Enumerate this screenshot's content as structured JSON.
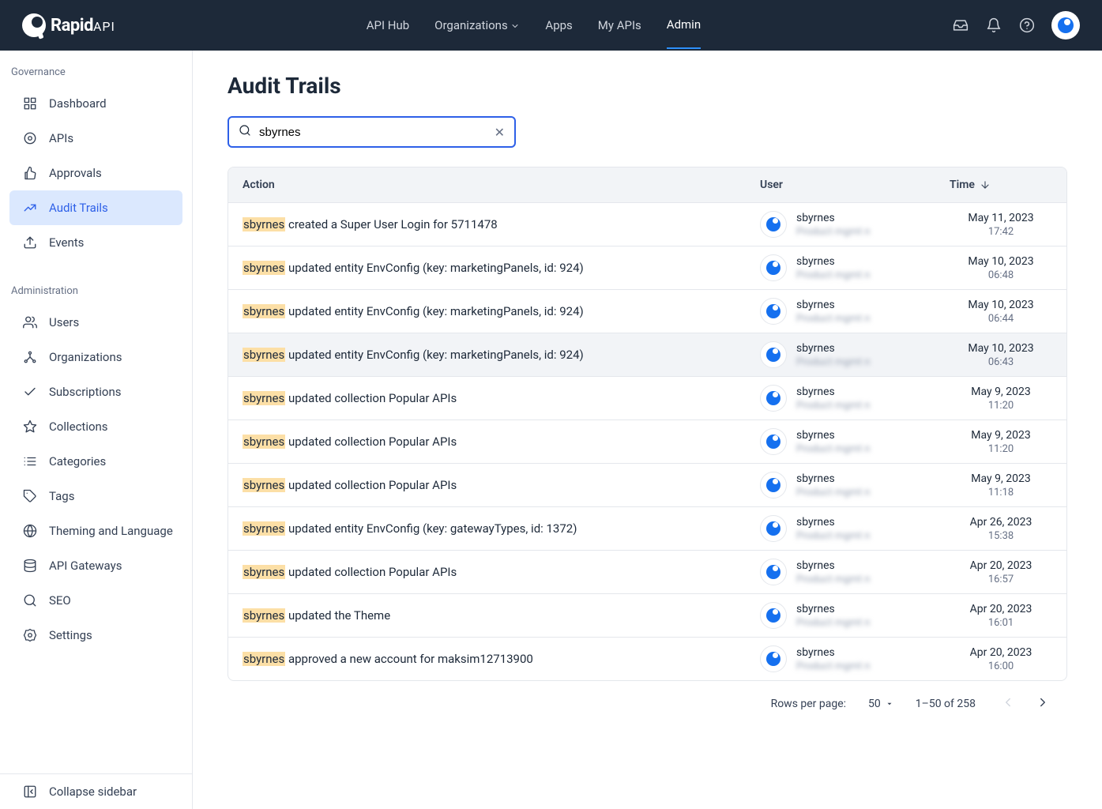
{
  "header": {
    "logo_text": "Rapid",
    "logo_api": "API",
    "nav": [
      "API Hub",
      "Organizations",
      "Apps",
      "My APIs",
      "Admin"
    ],
    "active_nav": 4
  },
  "sidebar": {
    "sections": [
      {
        "heading": "Governance",
        "items": [
          {
            "icon": "dashboard",
            "label": "Dashboard"
          },
          {
            "icon": "api",
            "label": "APIs"
          },
          {
            "icon": "thumbs-up",
            "label": "Approvals"
          },
          {
            "icon": "chart",
            "label": "Audit Trails",
            "active": true
          },
          {
            "icon": "upload",
            "label": "Events"
          }
        ]
      },
      {
        "heading": "Administration",
        "items": [
          {
            "icon": "users",
            "label": "Users"
          },
          {
            "icon": "org",
            "label": "Organizations"
          },
          {
            "icon": "check",
            "label": "Subscriptions"
          },
          {
            "icon": "star",
            "label": "Collections"
          },
          {
            "icon": "list",
            "label": "Categories"
          },
          {
            "icon": "tag",
            "label": "Tags"
          },
          {
            "icon": "globe",
            "label": "Theming and Language"
          },
          {
            "icon": "database",
            "label": "API Gateways"
          },
          {
            "icon": "search",
            "label": "SEO"
          },
          {
            "icon": "settings",
            "label": "Settings"
          }
        ]
      }
    ],
    "collapse": "Collapse sidebar"
  },
  "main": {
    "title": "Audit Trails",
    "search_value": "sbyrnes",
    "columns": {
      "action": "Action",
      "user": "User",
      "time": "Time"
    },
    "highlight_term": "sbyrnes",
    "rows": [
      {
        "action": "created a Super User Login for 5711478",
        "user": "sbyrnes",
        "sub": "Product mgmt n",
        "date": "May 11, 2023",
        "time": "17:42"
      },
      {
        "action": "updated entity EnvConfig (key: marketingPanels, id: 924)",
        "user": "sbyrnes",
        "sub": "Product mgmt n",
        "date": "May 10, 2023",
        "time": "06:48"
      },
      {
        "action": "updated entity EnvConfig (key: marketingPanels, id: 924)",
        "user": "sbyrnes",
        "sub": "Product mgmt n",
        "date": "May 10, 2023",
        "time": "06:44"
      },
      {
        "action": "updated entity EnvConfig (key: marketingPanels, id: 924)",
        "user": "sbyrnes",
        "sub": "Product mgmt n",
        "date": "May 10, 2023",
        "time": "06:43",
        "hover": true
      },
      {
        "action": "updated collection Popular APIs",
        "user": "sbyrnes",
        "sub": "Product mgmt n",
        "date": "May 9, 2023",
        "time": "11:20"
      },
      {
        "action": "updated collection Popular APIs",
        "user": "sbyrnes",
        "sub": "Product mgmt n",
        "date": "May 9, 2023",
        "time": "11:20"
      },
      {
        "action": "updated collection Popular APIs",
        "user": "sbyrnes",
        "sub": "Product mgmt n",
        "date": "May 9, 2023",
        "time": "11:18"
      },
      {
        "action": "updated entity EnvConfig (key: gatewayTypes, id: 1372)",
        "user": "sbyrnes",
        "sub": "Product mgmt n",
        "date": "Apr 26, 2023",
        "time": "15:38"
      },
      {
        "action": "updated collection Popular APIs",
        "user": "sbyrnes",
        "sub": "Product mgmt n",
        "date": "Apr 20, 2023",
        "time": "16:57"
      },
      {
        "action": "updated the Theme",
        "user": "sbyrnes",
        "sub": "Product mgmt n",
        "date": "Apr 20, 2023",
        "time": "16:01"
      },
      {
        "action": "approved a new account for maksim12713900",
        "user": "sbyrnes",
        "sub": "Product mgmt n",
        "date": "Apr 20, 2023",
        "time": "16:00"
      }
    ],
    "pagination": {
      "rows_per_page_label": "Rows per page:",
      "rows_per_page": "50",
      "range": "1–50 of 258"
    }
  }
}
